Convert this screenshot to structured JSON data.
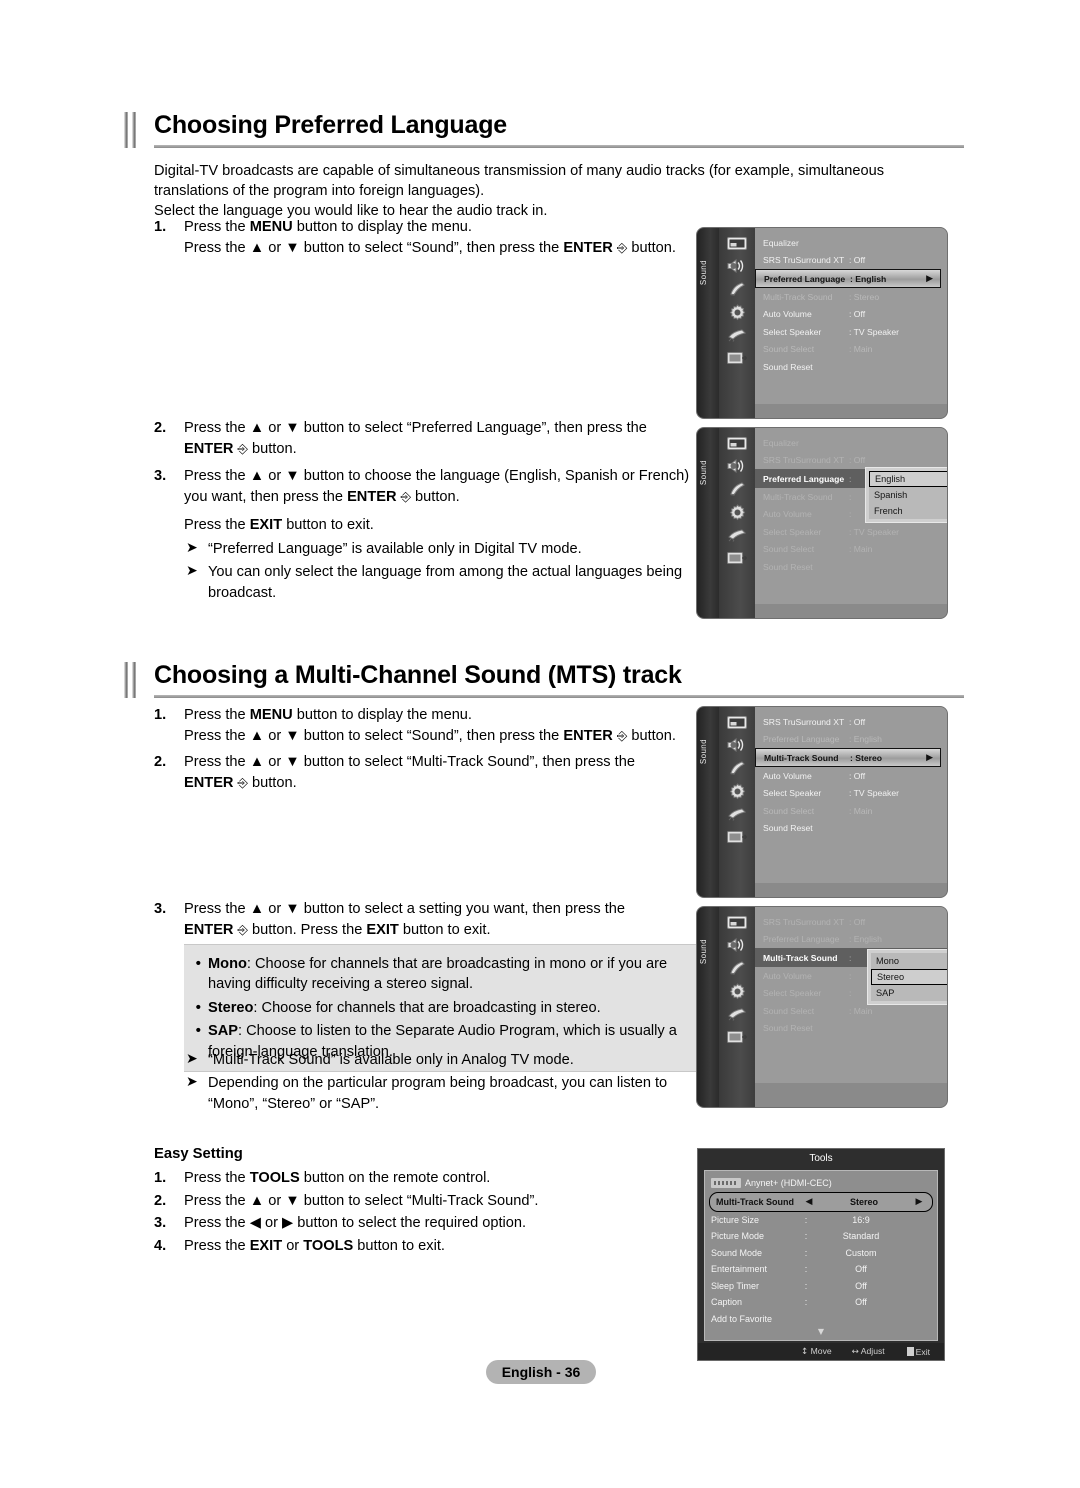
{
  "page": {
    "footer_badge": "English - 36"
  },
  "section1": {
    "title": "Choosing Preferred Language",
    "intro": "Digital-TV broadcasts are capable of simultaneous transmission of many audio tracks (for example, simultaneous translations of the program into foreign languages).",
    "intro2": "Select the language you would like to hear the audio track in.",
    "steps": [
      {
        "num": "1.",
        "line1_a": "Press the ",
        "line1_b": "MENU",
        "line1_c": " button to display the menu.",
        "line2_a": "Press the ▲ or ▼ button to select “Sound”, then press the ",
        "line2_b": "ENTER",
        "line2_c": " button."
      },
      {
        "num": "2.",
        "line1_a": "Press the ▲ or ▼ button to select “Preferred Language”, then press the ",
        "line1_b": "ENTER",
        "line1_c": " button."
      },
      {
        "num": "3.",
        "line1_a": "Press the ▲ or ▼ button to choose the language (English, Spanish or French) you want, then press the ",
        "line1_b": "ENTER",
        "line1_c": " button.",
        "line2_a": "Press the ",
        "line2_b": "EXIT",
        "line2_c": " button to exit."
      }
    ],
    "notes": [
      "“Preferred Language” is available only in Digital TV mode.",
      "You can only select the language from among the actual languages being broadcast."
    ]
  },
  "section2": {
    "title": "Choosing a Multi-Channel Sound (MTS) track",
    "steps": [
      {
        "num": "1.",
        "line1_a": "Press the ",
        "line1_b": "MENU",
        "line1_c": " button to display the menu.",
        "line2_a": "Press the ▲ or ▼ button to select “Sound”, then press the ",
        "line2_b": "ENTER",
        "line2_c": " button."
      },
      {
        "num": "2.",
        "line1_a": "Press the ▲ or ▼ button to select “Multi-Track Sound”, then press the ",
        "line1_b": "ENTER",
        "line1_c": " button."
      },
      {
        "num": "3.",
        "line1_a": "Press the ▲ or ▼ button to select a setting you want, then press the ",
        "line1_b": "ENTER",
        "line1_c": " button. Press the ",
        "line1_d": "EXIT",
        "line1_e": " button to exit."
      }
    ],
    "options": [
      {
        "name": "Mono",
        "desc": ": Choose for channels that are broadcasting in mono or if you are having difficulty receiving a stereo signal."
      },
      {
        "name": "Stereo",
        "desc": ": Choose for channels that are broadcasting in stereo."
      },
      {
        "name": "SAP",
        "desc": ": Choose to listen to the Separate Audio Program, which is usually a foreign-language translation."
      }
    ],
    "notes": [
      "“Multi-Track Sound” is available only in Analog TV mode.",
      "Depending on the particular program being broadcast, you can listen to “Mono”, “Stereo” or “SAP”."
    ]
  },
  "easy_setting": {
    "title": "Easy Setting",
    "steps": [
      {
        "num": "1.",
        "a": "Press the ",
        "b": "TOOLS",
        "c": " button on the remote control."
      },
      {
        "num": "2.",
        "a": "Press the ▲ or ▼ button to select “Multi-Track Sound”.",
        "b": "",
        "c": ""
      },
      {
        "num": "3.",
        "a": "Press the ◀ or ▶ button to select the required option.",
        "b": "",
        "c": ""
      },
      {
        "num": "4.",
        "a": "Press the ",
        "b": "EXIT",
        "c": " or ",
        "d": "TOOLS",
        "e": " button to exit."
      }
    ]
  },
  "osd_common": {
    "rail_label": "Sound",
    "icons": [
      "picture-icon",
      "sound-icon",
      "channel-icon",
      "setup-icon",
      "input-icon",
      "support-icon"
    ]
  },
  "osd1": {
    "rows": [
      {
        "label": "Equalizer",
        "value": "",
        "state": "normal"
      },
      {
        "label": "SRS TruSurround XT",
        "value": ": Off",
        "state": "normal"
      },
      {
        "label": "Preferred Language",
        "value": ": English",
        "state": "selected"
      },
      {
        "label": "Multi-Track Sound",
        "value": ": Stereo",
        "state": "dim"
      },
      {
        "label": "Auto Volume",
        "value": ": Off",
        "state": "normal"
      },
      {
        "label": "Select Speaker",
        "value": ": TV Speaker",
        "state": "normal"
      },
      {
        "label": "Sound Select",
        "value": ": Main",
        "state": "dim"
      },
      {
        "label": "Sound Reset",
        "value": "",
        "state": "normal"
      }
    ]
  },
  "osd2": {
    "rows": [
      {
        "label": "Equalizer",
        "value": "",
        "state": "dim"
      },
      {
        "label": "SRS TruSurround XT",
        "value": ": Off",
        "state": "dim"
      },
      {
        "label": "Preferred Language",
        "value": ":",
        "state": "selectedflat"
      },
      {
        "label": "Multi-Track Sound",
        "value": ":",
        "state": "dim"
      },
      {
        "label": "Auto Volume",
        "value": ":",
        "state": "dim"
      },
      {
        "label": "Select Speaker",
        "value": ": TV Speaker",
        "state": "dim"
      },
      {
        "label": "Sound Select",
        "value": ": Main",
        "state": "dim"
      },
      {
        "label": "Sound Reset",
        "value": "",
        "state": "dim"
      }
    ],
    "dropdown": {
      "options": [
        "English",
        "Spanish",
        "French"
      ],
      "current": "English"
    }
  },
  "osd3": {
    "rows": [
      {
        "label": "SRS TruSurround XT",
        "value": ": Off",
        "state": "normal"
      },
      {
        "label": "Preferred Language",
        "value": ": English",
        "state": "dim"
      },
      {
        "label": "Multi-Track Sound",
        "value": ": Stereo",
        "state": "selected"
      },
      {
        "label": "Auto Volume",
        "value": ": Off",
        "state": "normal"
      },
      {
        "label": "Select Speaker",
        "value": ": TV Speaker",
        "state": "normal"
      },
      {
        "label": "Sound Select",
        "value": ": Main",
        "state": "dim"
      },
      {
        "label": "Sound Reset",
        "value": "",
        "state": "normal"
      }
    ]
  },
  "osd4": {
    "rows": [
      {
        "label": "SRS TruSurround XT",
        "value": ": Off",
        "state": "dim"
      },
      {
        "label": "Preferred Language",
        "value": ": English",
        "state": "dim"
      },
      {
        "label": "Multi-Track Sound",
        "value": ":",
        "state": "selectedflat"
      },
      {
        "label": "Auto Volume",
        "value": ":",
        "state": "dim"
      },
      {
        "label": "Select Speaker",
        "value": ":",
        "state": "dim"
      },
      {
        "label": "Sound Select",
        "value": ": Main",
        "state": "dim"
      },
      {
        "label": "Sound Reset",
        "value": "",
        "state": "dim"
      }
    ],
    "dropdown": {
      "options": [
        "Mono",
        "Stereo",
        "SAP"
      ],
      "current": "Stereo"
    }
  },
  "tools": {
    "title": "Tools",
    "anynet_label": "Anynet+ (HDMI-CEC)",
    "highlight": {
      "label": "Multi-Track Sound",
      "left_arrow": "◀",
      "value": "Stereo",
      "right_arrow": "▶"
    },
    "rows": [
      {
        "label": "Picture Size",
        "sep": ":",
        "value": "16:9"
      },
      {
        "label": "Picture Mode",
        "sep": ":",
        "value": "Standard"
      },
      {
        "label": "Sound Mode",
        "sep": ":",
        "value": "Custom"
      },
      {
        "label": "Entertainment",
        "sep": ":",
        "value": "Off"
      },
      {
        "label": "Sleep Timer",
        "sep": ":",
        "value": "Off"
      },
      {
        "label": "Caption",
        "sep": ":",
        "value": "Off"
      },
      {
        "label": "Add to Favorite",
        "sep": "",
        "value": ""
      }
    ],
    "scroll_down": "▼",
    "footer": {
      "move": "Move",
      "adjust": "Adjust",
      "exit": "Exit",
      "move_icon": "↕",
      "adjust_icon": "↔",
      "exit_icon": "↩"
    }
  }
}
